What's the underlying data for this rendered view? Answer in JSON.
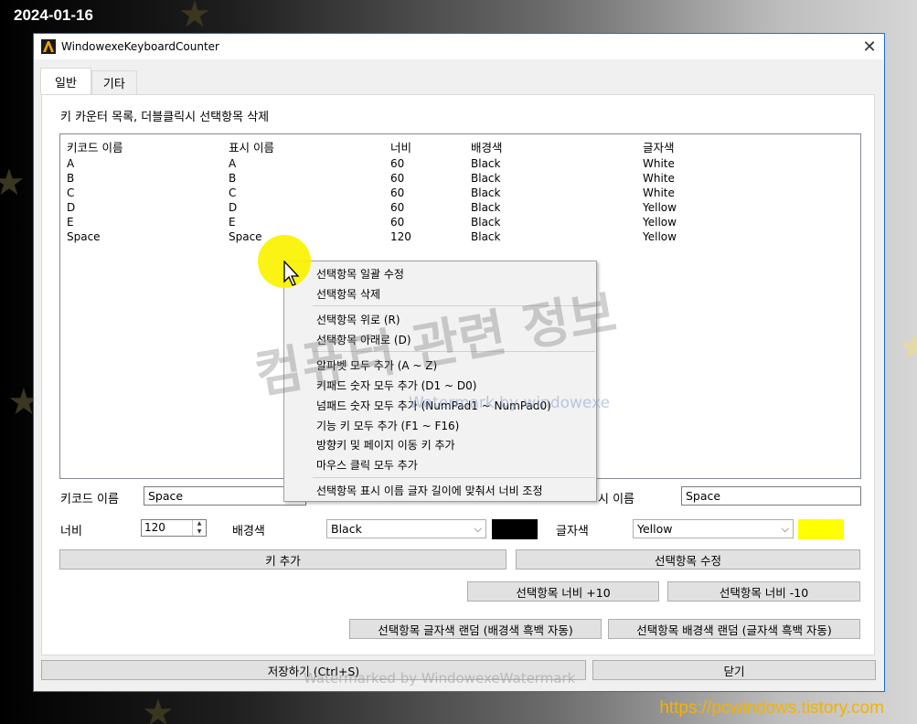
{
  "date_label": "2024-01-16",
  "blog_url": "https://pcwindows.tistory.com",
  "window": {
    "title": "WindowexeKeyboardCounter",
    "icon": "app-logo-icon",
    "close_glyph": "✕"
  },
  "tabs": [
    {
      "label": "일반",
      "active": true
    },
    {
      "label": "기타",
      "active": false
    }
  ],
  "list": {
    "caption": "키 카운터 목록, 더블클릭시 선택항목 삭제",
    "columns": [
      "키코드 이름",
      "표시 이름",
      "너비",
      "배경색",
      "글자색"
    ],
    "rows": [
      [
        "A",
        "A",
        "60",
        "Black",
        "White"
      ],
      [
        "B",
        "B",
        "60",
        "Black",
        "White"
      ],
      [
        "C",
        "C",
        "60",
        "Black",
        "White"
      ],
      [
        "D",
        "D",
        "60",
        "Black",
        "Yellow"
      ],
      [
        "E",
        "E",
        "60",
        "Black",
        "Yellow"
      ],
      [
        "Space",
        "Space",
        "120",
        "Black",
        "Yellow"
      ]
    ]
  },
  "form": {
    "keycode_label": "키코드 이름",
    "keycode_value": "Space",
    "display_label": "표시 이름",
    "display_label_visible": "시 이름",
    "display_value": "Space",
    "width_label": "너비",
    "width_value": "120",
    "bg_label": "배경색",
    "bg_value": "Black",
    "bg_color": "#000000",
    "fg_label": "글자색",
    "fg_value": "Yellow",
    "fg_color": "#ffff00"
  },
  "buttons": {
    "add_key": "키 추가",
    "edit_selected": "선택항목 수정",
    "width_plus": "선택항목 너비 +10",
    "width_minus": "선택항목 너비 -10",
    "random_fg": "선택항목 글자색 랜덤 (배경색 흑백 자동)",
    "random_bg": "선택항목 배경색 랜덤 (글자색 흑백 자동)",
    "save": "저장하기 (Ctrl+S)",
    "close": "닫기"
  },
  "context_menu": {
    "items": [
      "선택항목 일괄 수정",
      "선택항목 삭제",
      "선택항목 위로 (R)",
      "선택항목 아래로 (D)",
      "알파벳 모두 추가 (A ~ Z)",
      "키패드 숫자 모두 추가 (D1 ~ D0)",
      "넘패드 숫자 모두 추가 (NumPad1 ~ NumPad0)",
      "기능 키 모두 추가 (F1 ~ F16)",
      "방향키 및 페이지 이동 키 추가",
      "마우스 클릭 모두 추가",
      "선택항목 표시 이름 글자 길이에 맞춰서 너비 조정"
    ]
  },
  "watermarks": {
    "big": "컴퓨터 관련 정보",
    "small": "Watermark by windowexe",
    "bottom": "Watermarked by WindowexeWatermark"
  },
  "colors": {
    "window_border": "#1b6fd1",
    "highlight_dot": "#fbf200",
    "url_color": "#f4b200"
  }
}
